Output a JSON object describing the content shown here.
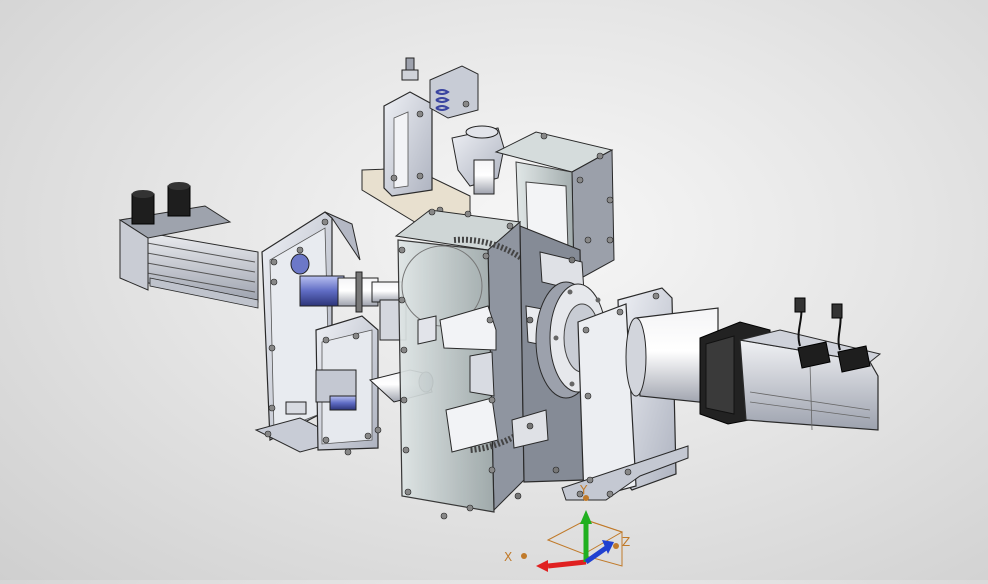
{
  "viewport": {
    "background_top": "#f4f4f4",
    "background_bottom": "#cfcfcf",
    "model_colors": {
      "steel": "#d9dde6",
      "steel_dark": "#8a90a0",
      "edge": "#2a2a2a",
      "motor_black": "#1e1e1e",
      "glass": "#c9d7d9",
      "coupling_blue": "#6c78c8"
    }
  },
  "triad": {
    "x_label": "X",
    "y_label": "Y",
    "z_label": "Z",
    "x_color": "#e02020",
    "y_color": "#20b020",
    "z_color": "#2040d0",
    "label_color": "#c07a2a"
  },
  "icons": [
    "coordinate-triad-icon"
  ]
}
